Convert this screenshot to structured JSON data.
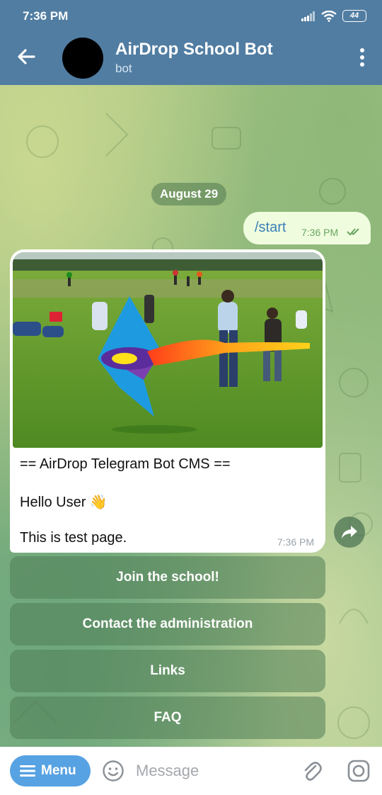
{
  "status_bar": {
    "time": "7:36 PM",
    "battery": "44"
  },
  "header": {
    "title": "AirDrop School Bot",
    "subtitle": "bot"
  },
  "date_separator": "August 29",
  "outgoing_message": {
    "text": "/start",
    "time": "7:36 PM"
  },
  "incoming_message": {
    "lines": [
      "== AirDrop Telegram Bot CMS ==",
      "Hello User 👋",
      "This is test page."
    ],
    "time": "7:36 PM"
  },
  "inline_keyboard": [
    "Join the school!",
    "Contact the administration",
    "Links",
    "FAQ"
  ],
  "composer": {
    "menu_label": "Menu",
    "placeholder": "Message"
  },
  "colors": {
    "header": "#517da2",
    "menu_button": "#57a2e2",
    "outgoing_bubble": "#effdde"
  }
}
